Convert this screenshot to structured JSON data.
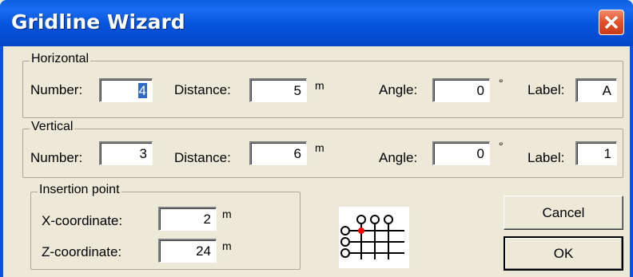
{
  "window": {
    "title": "Gridline Wizard"
  },
  "horizontal": {
    "legend": "Horizontal",
    "number_label": "Number:",
    "number_value": "4",
    "distance_label": "Distance:",
    "distance_value": "5",
    "distance_unit": "m",
    "angle_label": "Angle:",
    "angle_value": "0",
    "angle_unit": "°",
    "label_label": "Label:",
    "label_value": "A"
  },
  "vertical": {
    "legend": "Vertical",
    "number_label": "Number:",
    "number_value": "3",
    "distance_label": "Distance:",
    "distance_value": "6",
    "distance_unit": "m",
    "angle_label": "Angle:",
    "angle_value": "0",
    "angle_unit": "°",
    "label_label": "Label:",
    "label_value": "1"
  },
  "insertion": {
    "legend": "Insertion point",
    "x_label": "X-coordinate:",
    "x_value": "2",
    "x_unit": "m",
    "z_label": "Z-coordinate:",
    "z_value": "24",
    "z_unit": "m"
  },
  "buttons": {
    "cancel": "Cancel",
    "ok": "OK"
  },
  "colors": {
    "title_bar": "#0553dc",
    "dialog_bg": "#ece9d8",
    "selection": "#316ac5",
    "insertion_marker": "#ff0000"
  }
}
